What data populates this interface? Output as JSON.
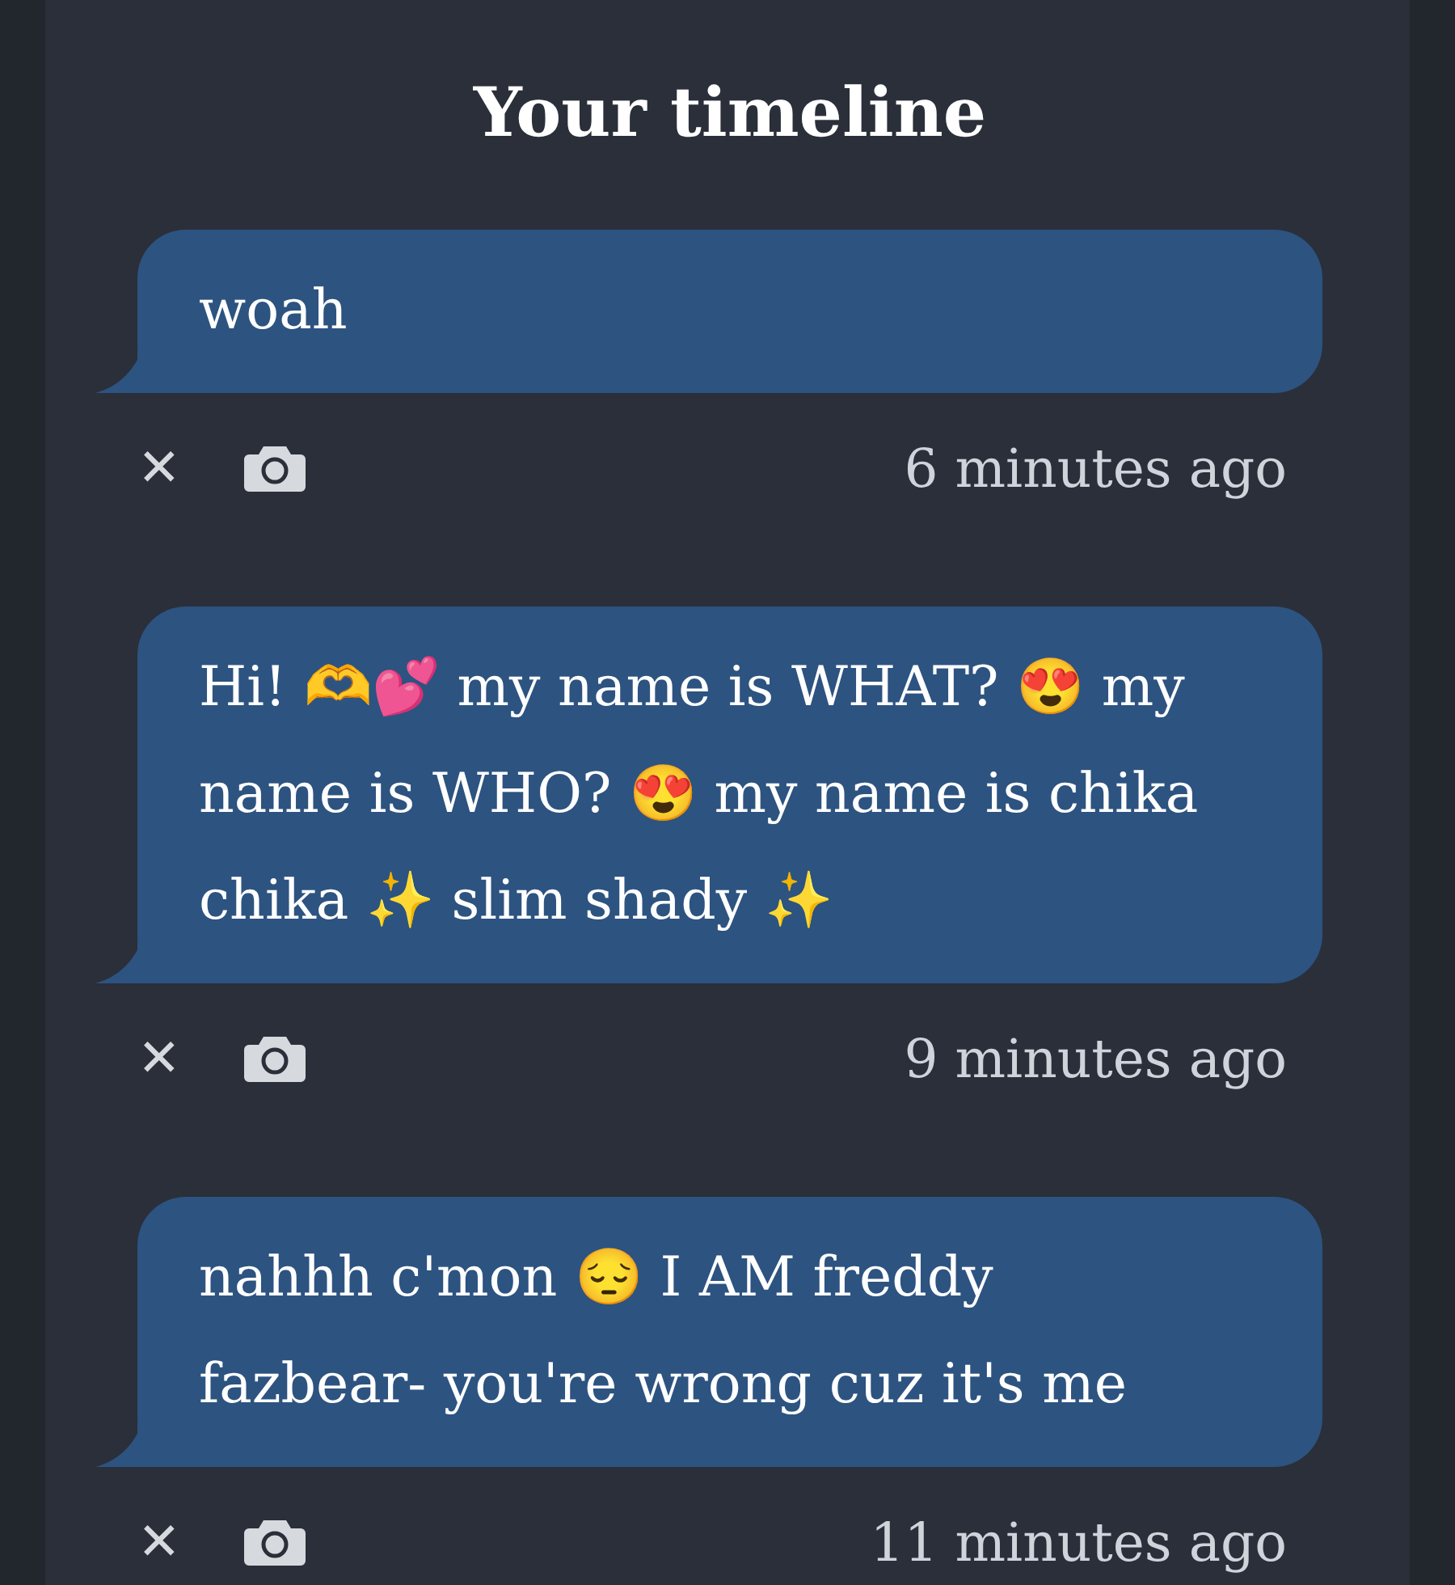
{
  "title": "Your timeline",
  "posts": [
    {
      "text": "woah",
      "time": "6 minutes ago"
    },
    {
      "text": "Hi! 🫶💕 my name is WHAT? 😍 my name is WHO? 😍 my name is chika chika ✨ slim shady ✨",
      "time": "9 minutes ago"
    },
    {
      "text": "nahhh c'mon 😔 I AM freddy fazbear- you're wrong cuz it's me",
      "time": "11 minutes ago"
    }
  ],
  "delete_symbol": "✕"
}
